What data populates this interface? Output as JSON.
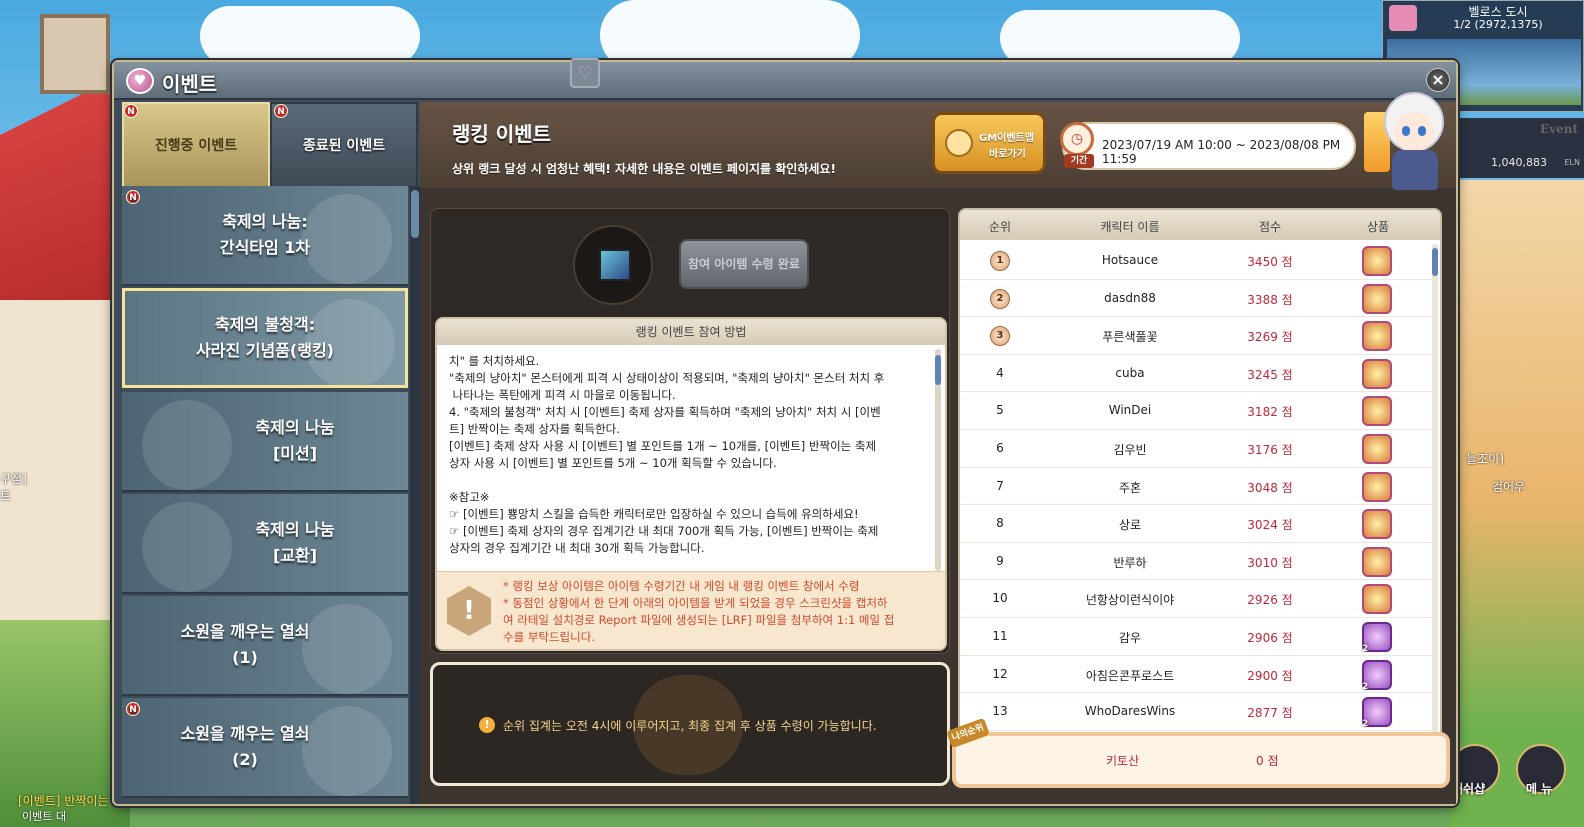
{
  "background": {
    "left_label": "구점]",
    "left_label2": "트",
    "chat_line": "[이벤트] 반짝이는",
    "chat_line2": "이벤트 대",
    "right_name1": "늘조이]",
    "right_name2": "검어우"
  },
  "minimap": {
    "title": "벨로스 도시",
    "coord": "1/2 (2972,1375)"
  },
  "side_panel": {
    "event_label": "Event",
    "meso": "1,040,883",
    "meso_unit": "ELN"
  },
  "bottom_buttons": {
    "cash_shop": "캐쉬샵",
    "menu": "메 뉴"
  },
  "window": {
    "title": "이벤트",
    "close_label": "×"
  },
  "tabs": {
    "ongoing": "진행중 이벤트",
    "ended": "종료된 이벤트",
    "badge": "N"
  },
  "events": [
    {
      "line1": "축제의 나눔:",
      "line2": "간식타임 1차",
      "badge": "N"
    },
    {
      "line1": "축제의 불청객:",
      "line2": "사라진 기념품(랭킹)",
      "badge": ""
    },
    {
      "line1": "축제의 나눔",
      "line2": "[미션]",
      "badge": ""
    },
    {
      "line1": "축제의 나눔",
      "line2": "[교환]",
      "badge": ""
    },
    {
      "line1": "소원을 깨우는 열쇠",
      "line2": "(1)",
      "badge": ""
    },
    {
      "line1": "소원을 깨우는 열쇠",
      "line2": "(2)",
      "badge": "N"
    }
  ],
  "content": {
    "title": "랭킹 이벤트",
    "subtitle": "상위 랭크 달성 시 엄청난 혜택! 자세한 내용은 이벤트 페이지를 확인하세요!",
    "gm_button_line1": "GM이벤트맵",
    "gm_button_line2": "바로가기",
    "period_label": "기간",
    "period": "2023/07/19 AM 10:00 ~ 2023/08/08 PM 11:59",
    "item_button": "참여 아이템 수령 완료",
    "howto_header": "랭킹 이벤트 참여 방법",
    "howto_body": "치\" 를 처치하세요.\n\"축제의 냥아치\" 몬스터에게 피격 시 상태이상이 적용되며, \"축제의 냥아치\" 몬스터 처치 후\n 나타나는 폭탄에게 피격 시 마을로 이동됩니다.\n4. \"축제의 불청객\" 처치 시 [이벤트] 축제 상자를 획득하며 \"축제의 냥아치\" 처치 시 [이벤\n트] 반짝이는 축제 상자를 획득한다.\n[이벤트] 축제 상자 사용 시 [이벤트] 별 포인트를 1개 ~ 10개를, [이벤트] 반짝이는 축제\n상자 사용 시 [이벤트] 별 포인트를 5개 ~ 10개 획득할 수 있습니다.\n\n※참고※\n☞ [이벤트] 뿅망치 스킬을 습득한 캐릭터로만 입장하실 수 있으니 습득에 유의하세요!\n☞ [이벤트] 축제 상자의 경우 집계기간 내 최대 700개 획득 가능, [이벤트] 반짝이는 축제\n상자의 경우 집계기간 내 최대 30개 획득 가능합니다.",
    "notice": "* 랭킹 보상 아이템은 아이템 수령기간 내 게임 내 랭킹 이벤트 창에서 수령\n* 동점인 상황에서 한 단계 아래의 아이템을 받게 되었을 경우 스크린샷을 캡처하\n여 라테일 설치경로 Report 파일에 생성되는 [LRF] 파일을 첨부하여 1:1 메일 접\n수를 부탁드립니다.",
    "notice_icon": "!",
    "bottom_message": "순위 집계는 오전 4시에 이루어지고, 최종 집계 후 상품 수령이 가능합니다.",
    "bottom_icon": "!"
  },
  "ranking": {
    "headers": {
      "rank": "순위",
      "name": "캐릭터 이름",
      "score": "점수",
      "prize": "상품"
    },
    "rows": [
      {
        "rank": "1",
        "name": "Hotsauce",
        "score": "3450 점",
        "prize": "gold",
        "count": ""
      },
      {
        "rank": "2",
        "name": "dasdn88",
        "score": "3388 점",
        "prize": "gold",
        "count": ""
      },
      {
        "rank": "3",
        "name": "푸른색풀꽃",
        "score": "3269 점",
        "prize": "gold",
        "count": ""
      },
      {
        "rank": "4",
        "name": "cuba",
        "score": "3245 점",
        "prize": "gold",
        "count": ""
      },
      {
        "rank": "5",
        "name": "WinDei",
        "score": "3182 점",
        "prize": "gold",
        "count": ""
      },
      {
        "rank": "6",
        "name": "김우빈",
        "score": "3176 점",
        "prize": "gold",
        "count": ""
      },
      {
        "rank": "7",
        "name": "주혼",
        "score": "3048 점",
        "prize": "gold",
        "count": ""
      },
      {
        "rank": "8",
        "name": "상로",
        "score": "3024 점",
        "prize": "gold",
        "count": ""
      },
      {
        "rank": "9",
        "name": "반루하",
        "score": "3010 점",
        "prize": "gold",
        "count": ""
      },
      {
        "rank": "10",
        "name": "넌항상이런식이야",
        "score": "2926 점",
        "prize": "gold",
        "count": ""
      },
      {
        "rank": "11",
        "name": "감우",
        "score": "2906 점",
        "prize": "purple",
        "count": "2"
      },
      {
        "rank": "12",
        "name": "아침은콘푸로스트",
        "score": "2900 점",
        "prize": "purple",
        "count": "2"
      },
      {
        "rank": "13",
        "name": "WhoDaresWins",
        "score": "2877 점",
        "prize": "purple",
        "count": "2"
      }
    ],
    "my_tag": "나의순위",
    "my_name": "키토산",
    "my_score": "0 점"
  },
  "colors": {
    "score": "#c2283a",
    "active_tab": "#d8c78a",
    "window_frame": "#3e4c59"
  }
}
